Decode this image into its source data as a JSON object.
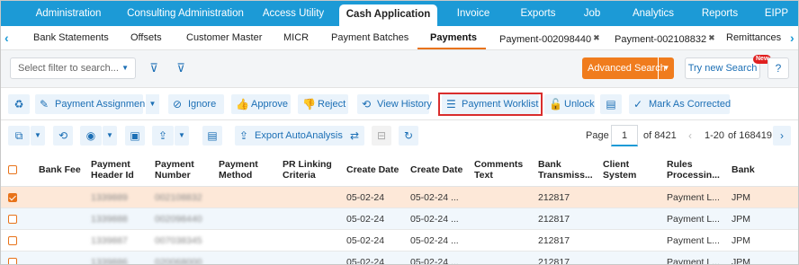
{
  "topnav": [
    "Administration",
    "Consulting Administration",
    "Access Utility",
    "Cash Application",
    "Invoice",
    "Exports",
    "Job",
    "Analytics",
    "Reports",
    "EIPP"
  ],
  "subnav": {
    "prev_icon": "chevron-left-icon",
    "next_icon": "chevron-right-icon",
    "tabs": [
      "Bank Statements",
      "Offsets",
      "Customer Master",
      "MICR",
      "Payment Batches",
      "Payments",
      "Payment-002098440",
      "Payment-002108832",
      "Remittances"
    ],
    "close_glyph": "✖"
  },
  "filter": {
    "placeholder": "Select filter to search...",
    "advanced_search": "Advanced Search",
    "try_new_search": "Try new Search",
    "new_badge": "New",
    "help_icon": "question-circle-icon"
  },
  "actions": {
    "payment_assignment": "Payment Assignment",
    "ignore": "Ignore",
    "approve": "Approve",
    "reject": "Reject",
    "view_history": "View History",
    "payment_worklist": "Payment Worklist",
    "unlock": "Unlock",
    "mark_as_corrected": "Mark As Corrected"
  },
  "gridbar": {
    "export_autoanalysis": "Export AutoAnalysis",
    "page_label": "Page",
    "page_value": "1",
    "page_of": "of 8421",
    "range": "1-20",
    "range_of": "of 168419"
  },
  "columns": [
    "Bank Fee",
    "Payment Header Id",
    "Payment Number",
    "Payment Method",
    "PR Linking Criteria",
    "Create Date",
    "Create Date",
    "Comments Text",
    "Bank Transmiss...",
    "Client System",
    "Rules Processin...",
    "Bank"
  ],
  "rows": [
    {
      "selected": true,
      "header_id": "1339889",
      "payment_number": "002108832",
      "create_date_1": "05-02-24",
      "create_date_2": "05-02-24 ...",
      "bank_transmission": "212817",
      "rules": "Payment L...",
      "bank": "JPM"
    },
    {
      "selected": false,
      "header_id": "1339888",
      "payment_number": "002098440",
      "create_date_1": "05-02-24",
      "create_date_2": "05-02-24 ...",
      "bank_transmission": "212817",
      "rules": "Payment L...",
      "bank": "JPM"
    },
    {
      "selected": false,
      "header_id": "1339887",
      "payment_number": "007038345",
      "create_date_1": "05-02-24",
      "create_date_2": "05-02-24 ...",
      "bank_transmission": "212817",
      "rules": "Payment L...",
      "bank": "JPM"
    },
    {
      "selected": false,
      "header_id": "1339886",
      "payment_number": "020068000",
      "create_date_1": "05-02-24",
      "create_date_2": "05-02-24 ...",
      "bank_transmission": "212817",
      "rules": "Payment L...",
      "bank": "JPM"
    }
  ],
  "colors": {
    "brand_blue": "#1c9ad6",
    "accent_orange": "#e8731a",
    "highlight_red": "#d92d2d"
  }
}
